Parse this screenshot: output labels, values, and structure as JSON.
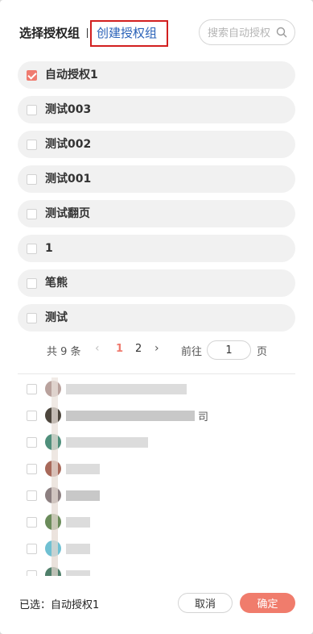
{
  "header": {
    "title": "选择授权组",
    "create_link": "创建授权组",
    "search_placeholder": "搜索自动授权"
  },
  "groups": [
    {
      "label": "自动授权1",
      "checked": true
    },
    {
      "label": "测试003",
      "checked": false
    },
    {
      "label": "测试002",
      "checked": false
    },
    {
      "label": "测试001",
      "checked": false
    },
    {
      "label": "测试翻页",
      "checked": false
    },
    {
      "label": "1",
      "checked": false
    },
    {
      "label": "笔熊",
      "checked": false
    },
    {
      "label": "测试",
      "checked": false
    }
  ],
  "pagination": {
    "total": "共 9 条",
    "prev": "‹",
    "pages": [
      "1",
      "2"
    ],
    "current": "1",
    "next": "›",
    "goto_label": "前往",
    "goto_value": "1",
    "unit": "页"
  },
  "members": [
    {
      "avatar_color": "#b9a29d",
      "tail": ""
    },
    {
      "avatar_color": "#4d463d",
      "tail": "司"
    },
    {
      "avatar_color": "#4f8f7b",
      "tail": ""
    },
    {
      "avatar_color": "#a8695a",
      "tail": ""
    },
    {
      "avatar_color": "#8c7f80",
      "tail": ""
    },
    {
      "avatar_color": "#6a8b5a",
      "tail": ""
    },
    {
      "avatar_color": "#6fc0d2",
      "tail": ""
    },
    {
      "avatar_color": "#4f7f6a",
      "tail": ""
    }
  ],
  "footer": {
    "selected": "已选：自动授权1",
    "cancel": "取消",
    "confirm": "确定"
  },
  "colors": {
    "accent": "#f07c6c",
    "link": "#2a62b8",
    "highlight_border": "#d21f1f"
  }
}
